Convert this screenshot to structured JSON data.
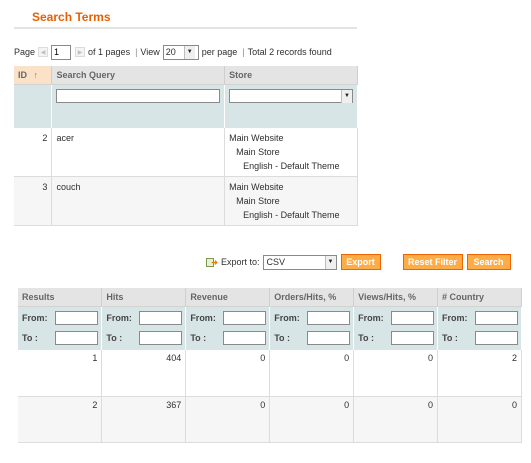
{
  "header": {
    "title": "Search Terms"
  },
  "pager": {
    "page_label": "Page",
    "prev_icon": "arrow-left-icon",
    "current_page": "1",
    "next_icon": "arrow-right-icon",
    "of_pages": "of 1 pages",
    "separator": "|",
    "view_label": "View",
    "per_page_value": "20",
    "per_page_label": "per page",
    "total_text": "Total 2 records found"
  },
  "terms_grid": {
    "columns": [
      {
        "label": "ID",
        "sort_icon": "sort-up-arrow-icon",
        "sort_glyph": "↑"
      },
      {
        "label": "Search Query"
      },
      {
        "label": "Store"
      }
    ],
    "rows": [
      {
        "id": "2",
        "query": "acer",
        "store": [
          "Main Website",
          "Main Store",
          "English - Default Theme"
        ]
      },
      {
        "id": "3",
        "query": "couch",
        "store": [
          "Main Website",
          "Main Store",
          "English - Default Theme"
        ]
      }
    ]
  },
  "actions": {
    "export_icon": "export-icon",
    "export_label": "Export to:",
    "export_format": "CSV",
    "export_button": "Export",
    "reset_button": "Reset Filter",
    "search_button": "Search",
    "accent_color": "#ffac47",
    "accent_border": "#ed6502"
  },
  "stats_grid": {
    "columns": [
      "Results",
      "Hits",
      "Revenue",
      "Orders/Hits, %",
      "Views/Hits, %",
      "# Country"
    ],
    "from_label": "From:",
    "to_label": "To :",
    "rows": [
      [
        "1",
        "404",
        "0",
        "0",
        "0",
        "2"
      ],
      [
        "2",
        "367",
        "0",
        "0",
        "0",
        "0"
      ]
    ]
  },
  "colors": {
    "title": "#eb5e00",
    "header_bg": "#e4e4e4",
    "filter_bg": "#d7e5e6",
    "sorted_header_bg": "#f9e2c8"
  }
}
